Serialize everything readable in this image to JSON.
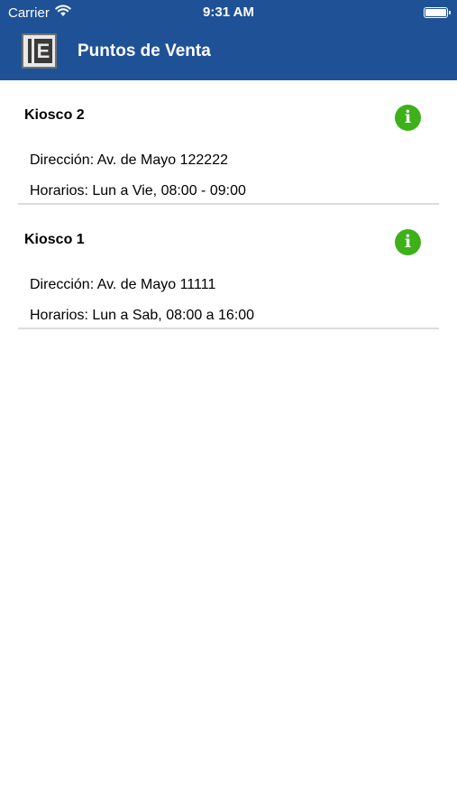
{
  "status_bar": {
    "carrier": "Carrier",
    "time": "9:31 AM"
  },
  "nav": {
    "logo_letter": "E",
    "title": "Puntos de Venta"
  },
  "colors": {
    "header": "#1f5196",
    "info_icon": "#3db01a",
    "divider": "#dcdcdc"
  },
  "icons": {
    "info": "info-icon",
    "wifi": "wifi-icon",
    "battery": "battery-icon"
  },
  "points_of_sale": [
    {
      "name": "Kiosco 2",
      "info_glyph": "i",
      "address": "Dirección: Av. de Mayo 122222",
      "hours": "Horarios: Lun a Vie, 08:00 - 09:00"
    },
    {
      "name": "Kiosco 1",
      "info_glyph": "i",
      "address": "Dirección: Av. de Mayo 11111",
      "hours": "Horarios: Lun a Sab, 08:00 a 16:00"
    }
  ]
}
